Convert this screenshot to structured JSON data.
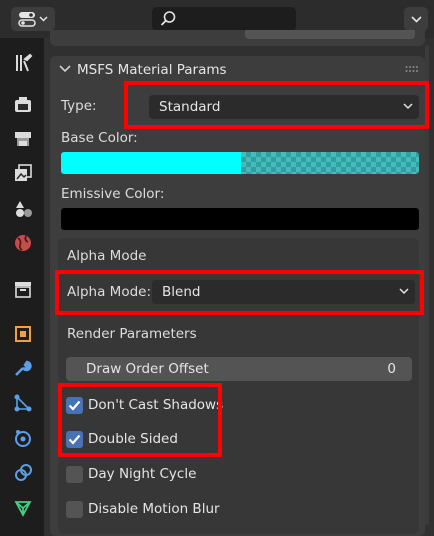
{
  "header": {
    "editor_type_icon": "properties-editor-icon",
    "search_placeholder": "",
    "options_icon": "chevron-down-icon"
  },
  "sidebar": {
    "tabs": [
      {
        "name": "tool",
        "icon": "tool-icon"
      },
      {
        "name": "render",
        "icon": "render-icon"
      },
      {
        "name": "output",
        "icon": "output-icon"
      },
      {
        "name": "view-layer",
        "icon": "view-layer-icon"
      },
      {
        "name": "scene",
        "icon": "scene-icon"
      },
      {
        "name": "world",
        "icon": "world-icon"
      },
      {
        "name": "collection",
        "icon": "collection-icon"
      },
      {
        "name": "object",
        "icon": "object-icon"
      },
      {
        "name": "modifiers",
        "icon": "wrench-icon"
      },
      {
        "name": "particles",
        "icon": "particles-icon"
      },
      {
        "name": "physics",
        "icon": "physics-icon"
      },
      {
        "name": "constraints",
        "icon": "constraints-icon"
      },
      {
        "name": "data",
        "icon": "mesh-data-icon"
      }
    ]
  },
  "panel": {
    "title": "MSFS Material Params",
    "type_label": "Type:",
    "type_value": "Standard",
    "base_color_label": "Base Color:",
    "base_color": "#00ffff",
    "emissive_color_label": "Emissive Color:",
    "emissive_color": "#000000",
    "alpha_section_title": "Alpha Mode",
    "alpha_mode_label": "Alpha Mode:",
    "alpha_mode_value": "Blend",
    "render_params_title": "Render Parameters",
    "draw_order_label": "Draw Order Offset",
    "draw_order_value": "0",
    "checkboxes": [
      {
        "label": "Don't Cast Shadows",
        "checked": true
      },
      {
        "label": "Double Sided",
        "checked": true
      },
      {
        "label": "Day Night Cycle",
        "checked": false
      },
      {
        "label": "Disable Motion Blur",
        "checked": false
      }
    ]
  },
  "colors": {
    "highlight": "#ff0000",
    "checkbox_on": "#4772b3",
    "panel_bg": "#3d3d3d"
  }
}
